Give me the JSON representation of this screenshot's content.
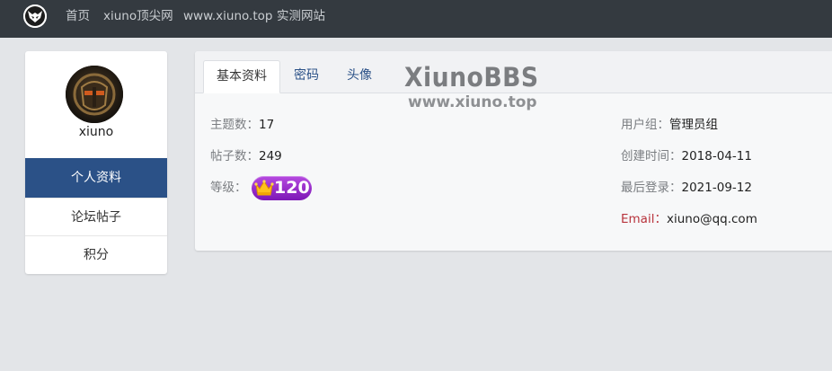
{
  "nav": {
    "links": [
      "首页",
      "xiuno顶尖网",
      "www.xiuno.top",
      "实测网站"
    ]
  },
  "profile": {
    "username": "xiuno",
    "menu": [
      "个人资料",
      "论坛帖子",
      "积分"
    ]
  },
  "tabs": [
    "基本资料",
    "密码",
    "头像"
  ],
  "watermark": {
    "title": "XiunoBBS",
    "url": "www.xiuno.top"
  },
  "stats": {
    "threads_label": "主题数：",
    "threads_value": "17",
    "posts_label": "帖子数：",
    "posts_value": "249",
    "level_label": "等级：",
    "level_value": "120"
  },
  "info": {
    "group_label": "用户组：",
    "group_value": "管理员组",
    "created_label": "创建时间：",
    "created_value": "2018-04-11",
    "last_login_label": "最后登录：",
    "last_login_value": "2021-09-12",
    "email_label": "Email：",
    "email_value": "xiuno@qq.com"
  },
  "colors": {
    "navbar": "#343a40",
    "active_menu": "#2b5187",
    "email_label": "#b8333c",
    "badge": "#9b2fd0"
  },
  "icons": {
    "logo": "xiuno-logo-icon",
    "crown": "crown-icon"
  }
}
